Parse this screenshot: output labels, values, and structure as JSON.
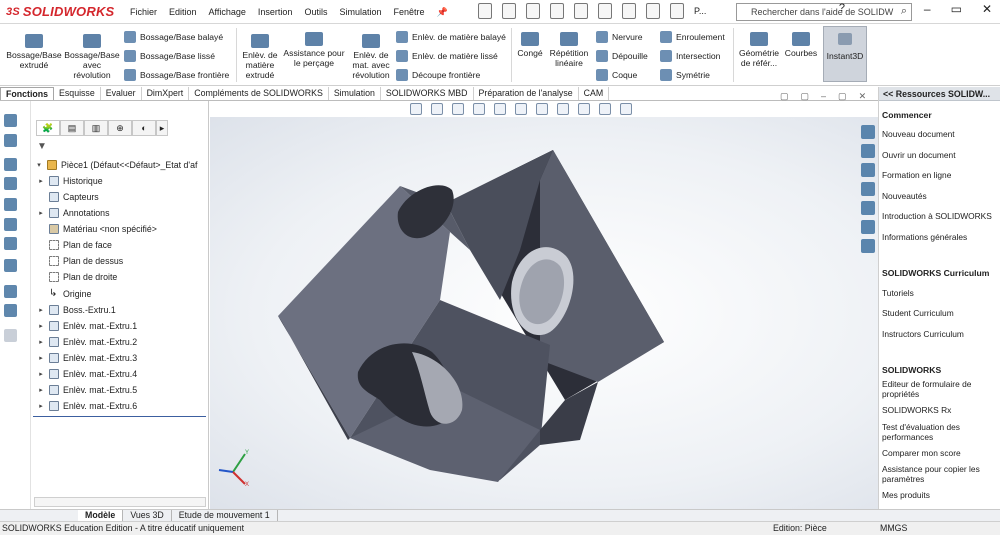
{
  "app": {
    "logo_text": "SOLIDWORKS",
    "logo_ds": "3S",
    "brand_color": "#d4262c"
  },
  "menu": [
    "Fichier",
    "Edition",
    "Affichage",
    "Insertion",
    "Outils",
    "Simulation",
    "Fenêtre"
  ],
  "toolbar": {
    "overflow": "P..."
  },
  "search": {
    "placeholder": "Rechercher dans l'aide de SOLIDW"
  },
  "ribbon": {
    "boss_extrude": "Bossage/Base extrudé",
    "boss_revolve": "Bossage/Base avec révolution",
    "swept_boss": "Bossage/Base balayé",
    "loft_boss": "Bossage/Base lissé",
    "boundary_boss": "Bossage/Base frontière",
    "extruded_cut": "Enlèv. de matière extrudé",
    "hole_wizard": "Assistance pour le perçage",
    "revolved_cut": "Enlèv. de mat. avec révolution",
    "swept_cut": "Enlèv. de matière balayé",
    "lofted_cut": "Enlèv. de matière lissé",
    "boundary_cut": "Découpe frontière",
    "fillet": "Congé",
    "pattern": "Répétition linéaire",
    "rib": "Nervure",
    "draft": "Dépouille",
    "shell": "Coque",
    "wrap": "Enroulement",
    "intersect": "Intersection",
    "mirror": "Symétrie",
    "ref_geometry": "Géométrie de référ...",
    "curves": "Courbes",
    "instant3d": "Instant3D"
  },
  "tabs": [
    "Fonctions",
    "Esquisse",
    "Evaluer",
    "DimXpert",
    "Compléments de SOLIDWORKS",
    "Simulation",
    "SOLIDWORKS MBD",
    "Préparation de l'analyse",
    "CAM"
  ],
  "tree": {
    "root": "Pièce1  (Défaut<<Défaut>_Etat d'af",
    "items": [
      {
        "label": "Historique",
        "arrow": "▸",
        "kind": "folder"
      },
      {
        "label": "Capteurs",
        "arrow": "",
        "kind": "folder"
      },
      {
        "label": "Annotations",
        "arrow": "▸",
        "kind": "folder"
      },
      {
        "label": "Matériau <non spécifié>",
        "arrow": "",
        "kind": "material"
      },
      {
        "label": "Plan de face",
        "arrow": "",
        "kind": "plane"
      },
      {
        "label": "Plan de dessus",
        "arrow": "",
        "kind": "plane"
      },
      {
        "label": "Plan de droite",
        "arrow": "",
        "kind": "plane"
      },
      {
        "label": "Origine",
        "arrow": "",
        "kind": "origin"
      },
      {
        "label": "Boss.-Extru.1",
        "arrow": "▸",
        "kind": "feature"
      },
      {
        "label": "Enlèv. mat.-Extru.1",
        "arrow": "▸",
        "kind": "feature"
      },
      {
        "label": "Enlèv. mat.-Extru.2",
        "arrow": "▸",
        "kind": "feature"
      },
      {
        "label": "Enlèv. mat.-Extru.3",
        "arrow": "▸",
        "kind": "feature"
      },
      {
        "label": "Enlèv. mat.-Extru.4",
        "arrow": "▸",
        "kind": "feature"
      },
      {
        "label": "Enlèv. mat.-Extru.5",
        "arrow": "▸",
        "kind": "feature"
      },
      {
        "label": "Enlèv. mat.-Extru.6",
        "arrow": "▸",
        "kind": "feature"
      }
    ]
  },
  "resources": {
    "header": "<< Ressources SOLIDW...",
    "sections": [
      {
        "title": "Commencer",
        "items": [
          "Nouveau document",
          "Ouvrir un document",
          "Formation en ligne",
          "Nouveautés",
          "Introduction à SOLIDWORKS",
          "Informations générales"
        ]
      },
      {
        "title": "SOLIDWORKS Curriculum",
        "items": [
          "Tutoriels",
          "Student Curriculum",
          "Instructors Curriculum"
        ]
      },
      {
        "title": "SOLIDWORKS",
        "items": [
          "Editeur de formulaire de propriétés",
          "SOLIDWORKS Rx",
          "Test d'évaluation des performances",
          "Comparer mon score",
          "Assistance pour copier les paramètres",
          "Mes produits"
        ]
      }
    ]
  },
  "bottom_tabs": [
    "Modèle",
    "Vues 3D",
    "Etude de mouvement 1"
  ],
  "status": {
    "edition": "SOLIDWORKS Education Edition - A titre éducatif uniquement",
    "mode": "Edition: Pièce",
    "units": "MMGS"
  },
  "model": {
    "face_color": "#676b7a",
    "dark_face": "#3f424e",
    "top_face": "#8a8d9a"
  }
}
